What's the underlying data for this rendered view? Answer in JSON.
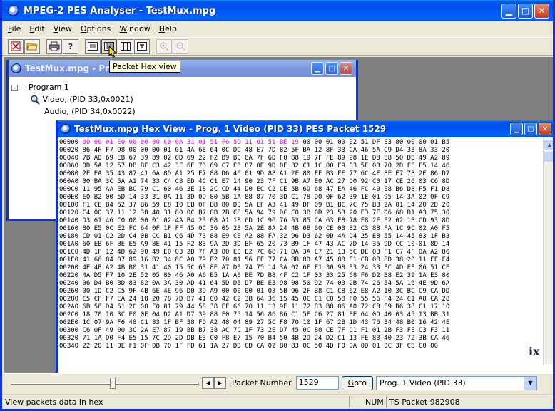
{
  "app": {
    "title": "MPEG-2 PES Analyser - TestMux.mpg",
    "caption_buttons": [
      "minimize",
      "maximize",
      "close"
    ]
  },
  "menu": [
    {
      "label": "File",
      "u": "F",
      "rest": "ile"
    },
    {
      "label": "Edit",
      "u": "E",
      "rest": "dit"
    },
    {
      "label": "View",
      "u": "V",
      "rest": "iew"
    },
    {
      "label": "Options",
      "u": "O",
      "rest": "ptions"
    },
    {
      "label": "Window",
      "u": "W",
      "rest": "indow"
    },
    {
      "label": "Help",
      "u": "H",
      "rest": "elp"
    }
  ],
  "toolbar": {
    "tooltip": "Packet Hex view",
    "buttons": [
      "close-file",
      "open-file",
      "print",
      "help",
      "packet-list-view",
      "packet-hex-view",
      "packet-split-view",
      "packet-info-view",
      "zoom-in",
      "zoom-out"
    ]
  },
  "tree_window": {
    "title": "TestMux.mpg - Pro",
    "root": "Program 1",
    "items": [
      "Video, (PID 33,0x0021)",
      "Audio, (PID 34,0x0022)"
    ]
  },
  "hex_window": {
    "title": "TestMux.mpg Hex View - Prog. 1 Video (PID 33) PES Packet 1529",
    "lines": [
      {
        "off": "00000",
        "hl": "00 00 01 E0 00 00 80 C0 0A 31 01 51 F6 59 11 01 51 BE 19",
        "rest": " 00 00 01 00 02 51 DF E3 80 00 00 01 B5"
      },
      {
        "off": "00020",
        "hl": "",
        "rest": " 86 4F F7 98 00 00 00 01 01 4A 6E 64 0C DC 48 E7 7D 82 5F BA 12 8F 33 CA 46 5A C9 D4 33 8A 33 20"
      },
      {
        "off": "00040",
        "hl": "",
        "rest": " 7B AD 69 EB 67 39 89 02 0D 69 22 F2 B9 BC 8A 7F 6D F0 88 19 7F FE 89 98 1E D8 E8 50 DB 49 A2 89"
      },
      {
        "off": "00060",
        "hl": "",
        "rest": " 0D 5A 12 57 DB BF C3 42 3F 6E 73 69 C7 E3 87 0E 9D 0E 82 C1 1C 00 F9 03 5E 03 70 2D FF F5 14 46"
      },
      {
        "off": "00080",
        "hl": "",
        "rest": " 2E EA 35 43 87 41 6A 8D A1 25 E7 88 D6 46 01 9D 88 A1 2F 80 FE B3 FE 77 6C 4F 8F E7 78 2E 86 D7"
      },
      {
        "off": "000A0",
        "hl": "",
        "rest": " 00 BA 3C 5A A1 74 33 C4 C8 ED 4C C1 E7 14 90 23 7F C1 9B A7 E0 AC 27 D0 92 C0 17 CE 26 03 C6 8D"
      },
      {
        "off": "000C0",
        "hl": "",
        "rest": " 11 95 AA EB BC 79 C1 60 46 3E 18 2C CD 44 D0 EC C2 CE 5B 6D 68 47 EA 46 FC 40 E8 B6 D8 F5 F1 D8"
      },
      {
        "off": "000E0",
        "hl": "",
        "rest": " E0 B2 00 5D 14 33 31 0A 11 3D 0D 80 5B 1A 88 87 70 3D C1 78 D0 0F 62 39 1E 01 95 14 3A 02 0F C9"
      },
      {
        "off": "00100",
        "hl": "",
        "rest": " F1 CE B4 62 37 B6 59 E8 10 EB 0F B8 80 D0 5A EF A3 41 49 DF 09 B1 BC 7C 75 B3 2A 01 14 20 2D 20"
      },
      {
        "off": "00120",
        "hl": "",
        "rest": " C4 00 37 11 12 38 40 31 80 0C B7 8B 2B CE 5A 94 79 DC C0 3B 0D 23 53 20 E3 7E D6 68 D1 A3 75 30"
      },
      {
        "off": "00140",
        "hl": "",
        "rest": " D3 61 46 C0 00 00 01 02 4A B4 23 08 A1 18 6D 1C 96 76 53 85 CA 63 F8 78 F8 2E E2 02 1B CD 93 8D"
      },
      {
        "off": "00160",
        "hl": "",
        "rest": " 80 E5 0C E2 FC 64 0F 1F FF 45 0C 36 05 23 5A 2E 8A 24 4B 0B 60 CE 03 82 C3 88 FA 1C 9C 02 A0 F5"
      },
      {
        "off": "00180",
        "hl": "",
        "rest": " CD 01 C2 2D C4 0B CC B1 C6 4D 73 88 E9 CE A2 88 FA 32 96 D3 62 0D 4A D4 25 E8 55 14 45 83 1F B3"
      },
      {
        "off": "001A0",
        "hl": "",
        "rest": " 60 EB 6F BE E5 A9 8E 41 15 F2 83 9A 2D 3D BF 65 20 73 B9 1F 47 43 AC 7D 14 35 9D CC 10 01 8D 14"
      },
      {
        "off": "001C0",
        "hl": "",
        "rest": " 4D 1F 12 4D 62 90 49 E0 03 2D 7F A3 80 E0 E2 7C 68 71 DA 3A E7 21 13 5C DE 03 F1 C7 4F 0A A2 86"
      },
      {
        "off": "001E0",
        "hl": "",
        "rest": " 41 66 84 07 89 16 B2 34 8C A0 79 E2 70 81 56 FF 77 CA BB 8D A7 45 88 E1 CB 0B 8D 38 20 11 FF F4"
      },
      {
        "off": "00200",
        "hl": "",
        "rest": " 4E 4B A2 4B B0 31 41 40 15 5C 63 8E A7 D0 74 75 14 3A 02 6F F1 30 98 33 24 33 FC 4D EE 06 51 CE"
      },
      {
        "off": "00220",
        "hl": "",
        "rest": " 4A D5 F7 10 2E 52 05 80 46 A0 A6 B5 1A A0 BE 7D B8 4F C2 1F 03 33 25 68 F6 D2 B8 E2 39 1A E3 80"
      },
      {
        "off": "00240",
        "hl": "",
        "rest": " 06 D4 B0 8D 83 82 0A 3A 30 AD 41 64 5D D5 D7 BE E3 98 08 50 92 74 03 2B 74 26 54 5A 16 4E 9D 6A"
      },
      {
        "off": "00260",
        "hl": "",
        "rest": " 00 1D C2 C5 9F 4B 6E 4E 96 D0 39 A9 00 00 00 01 03 5B 96 2F B8 C1 C8 62 E8 A2 10 3C BC C9 CA DD"
      },
      {
        "off": "00280",
        "hl": "",
        "rest": " C5 CF F7 EA 24 18 20 78 7D B7 41 C0 42 C2 3B 64 36 15 45 0C C1 C0 58 F0 55 56 F4 24 C1 A8 CA 28"
      },
      {
        "off": "002A0",
        "hl": "",
        "rest": " 6B 56 D4 51 2C 08 F0 01 79 44 58 38 EF 66 70 11 13 9E 11 72 83 B8 06 A0 72 C8 F9 D6 38 C1 17 10"
      },
      {
        "off": "002C0",
        "hl": "",
        "rest": " 18 70 10 3C E0 0E 04 D2 A1 D7 39 88 F0 75 14 56 86 86 C1 5E C6 27 81 EE 64 0D 40 03 45 13 BB 31"
      },
      {
        "off": "002E0",
        "hl": "",
        "rest": " 1C 07 9A F6 48 C1 83 1F BF 38 FD A2 48 04 89 27 5C F8 70 10 1F 67 2B 1D 43 76 34 48 B0 16 42 4E"
      },
      {
        "off": "00300",
        "hl": "",
        "rest": " C6 0F 49 00 3C 2A E7 87 19 8B B7 38 AC 7C 1F 73 2E D7 45 0C 80 CE 7F C1 F1 01 2B F3 FE C3 F3 11"
      },
      {
        "off": "00320",
        "hl": "",
        "rest": " 71 1A D0 F4 E5 15 7C 2D 2D DB E3 C0 F8 E7 15 70 B4 50 4B 2D 24 D2 C1 13 FE 83 40 23 72 3B CA 46"
      },
      {
        "off": "00340",
        "hl": "",
        "rest": " 22 20 11 0E F1 0F 0B 70 1F FD 61 1A 27 DD CD CA 02 B0 83 0C 50 4D F0 0A 0D 01 0C 3F CB C0 00"
      }
    ]
  },
  "nav": {
    "packet_number_label": "Packet Number",
    "packet_number_value": "1529",
    "goto_label": "Goto",
    "goto_u": "G",
    "goto_rest": "oto",
    "stream_selected": "Prog. 1 Video (PID 33)"
  },
  "status": {
    "message": "View packets data in hex",
    "num": "NUM",
    "ts_packet": "TS Packet 982908"
  },
  "background": {
    "logo_fragment": "ix"
  }
}
